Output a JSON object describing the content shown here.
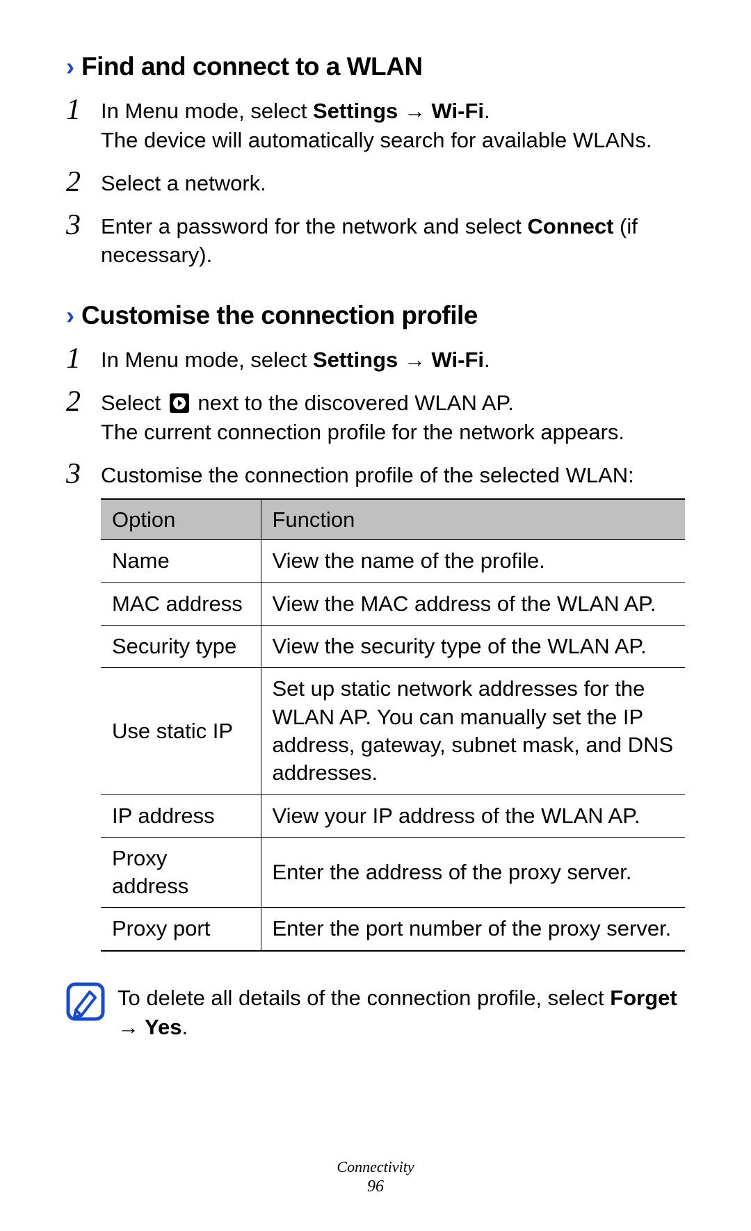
{
  "sections": [
    {
      "heading": "Find and connect to a WLAN",
      "steps": [
        {
          "num": "1",
          "line1_prefix": "In Menu mode, select ",
          "line1_bold": "Settings → Wi-Fi",
          "line1_suffix": ".",
          "line2": "The device will automatically search for available WLANs."
        },
        {
          "num": "2",
          "line1_prefix": "Select a network.",
          "line1_bold": "",
          "line1_suffix": ""
        },
        {
          "num": "3",
          "line1_prefix": "Enter a password for the network and select ",
          "line1_bold": "Connect",
          "line1_suffix": " (if necessary)."
        }
      ]
    },
    {
      "heading": "Customise the connection profile",
      "steps": [
        {
          "num": "1",
          "line1_prefix": "In Menu mode, select ",
          "line1_bold": "Settings → Wi-Fi",
          "line1_suffix": "."
        },
        {
          "num": "2",
          "line1_prefix": "Select ",
          "has_icon": true,
          "line1_after_icon": " next to the discovered WLAN AP.",
          "line2": "The current connection profile for the network appears."
        },
        {
          "num": "3",
          "line1_prefix": "Customise the connection profile of the selected WLAN:"
        }
      ]
    }
  ],
  "table": {
    "headers": [
      "Option",
      "Function"
    ],
    "rows": [
      [
        "Name",
        "View the name of the profile."
      ],
      [
        "MAC address",
        "View the MAC address of the WLAN AP."
      ],
      [
        "Security type",
        "View the security type of the WLAN AP."
      ],
      [
        "Use static IP",
        "Set up static network addresses for the WLAN AP. You can manually set the IP address, gateway, subnet mask, and DNS addresses."
      ],
      [
        "IP address",
        "View your IP address of the WLAN AP."
      ],
      [
        "Proxy address",
        "Enter the address of the proxy server."
      ],
      [
        "Proxy port",
        "Enter the port number of the proxy server."
      ]
    ]
  },
  "note": {
    "text_prefix": "To delete all details of the connection profile, select ",
    "text_bold": "Forget → Yes",
    "text_suffix": "."
  },
  "footer": {
    "section": "Connectivity",
    "page": "96"
  }
}
